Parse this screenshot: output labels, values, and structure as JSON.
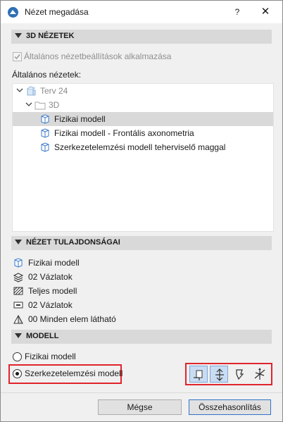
{
  "window": {
    "title": "Nézet megadása",
    "help": "?",
    "close": "✕"
  },
  "section_3d": {
    "label": "3D NÉZETEK"
  },
  "apply_general": {
    "label": "Általános nézetbeállítások alkalmazása",
    "checked": true
  },
  "general_views": {
    "label": "Általános nézetek:",
    "tree": [
      {
        "label": "Terv 24"
      },
      {
        "label": "3D"
      },
      {
        "label": "Fizikai modell",
        "selected": true
      },
      {
        "label": "Fizikai modell - Frontális axonometria"
      },
      {
        "label": "Szerkezetelemzési modell teherviselő maggal"
      }
    ]
  },
  "section_props": {
    "label": "NÉZET TULAJDONSÁGAI"
  },
  "props": [
    {
      "icon": "model-view-icon",
      "label": "Fizikai modell"
    },
    {
      "icon": "layers-icon",
      "label": "02 Vázlatok"
    },
    {
      "icon": "hatch-icon",
      "label": "Teljes modell"
    },
    {
      "icon": "dimension-icon",
      "label": "02 Vázlatok"
    },
    {
      "icon": "renovation-icon",
      "label": "00 Minden elem látható"
    }
  ],
  "section_model": {
    "label": "MODELL"
  },
  "model_options": [
    {
      "label": "Fizikai modell",
      "selected": false
    },
    {
      "label": "Szerkezetelemzési modell",
      "selected": true
    }
  ],
  "toolbar": [
    "analytical-member-icon",
    "support-icon",
    "surface-icon",
    "load-axis-icon"
  ],
  "buttons": {
    "cancel": "Mégse",
    "compare": "Összehasonlítás"
  },
  "colors": {
    "highlight_red": "#e0242b",
    "section_bg": "#d9d9d9",
    "selection_bg": "#d9d9d9",
    "primary_border": "#2f73c9"
  }
}
